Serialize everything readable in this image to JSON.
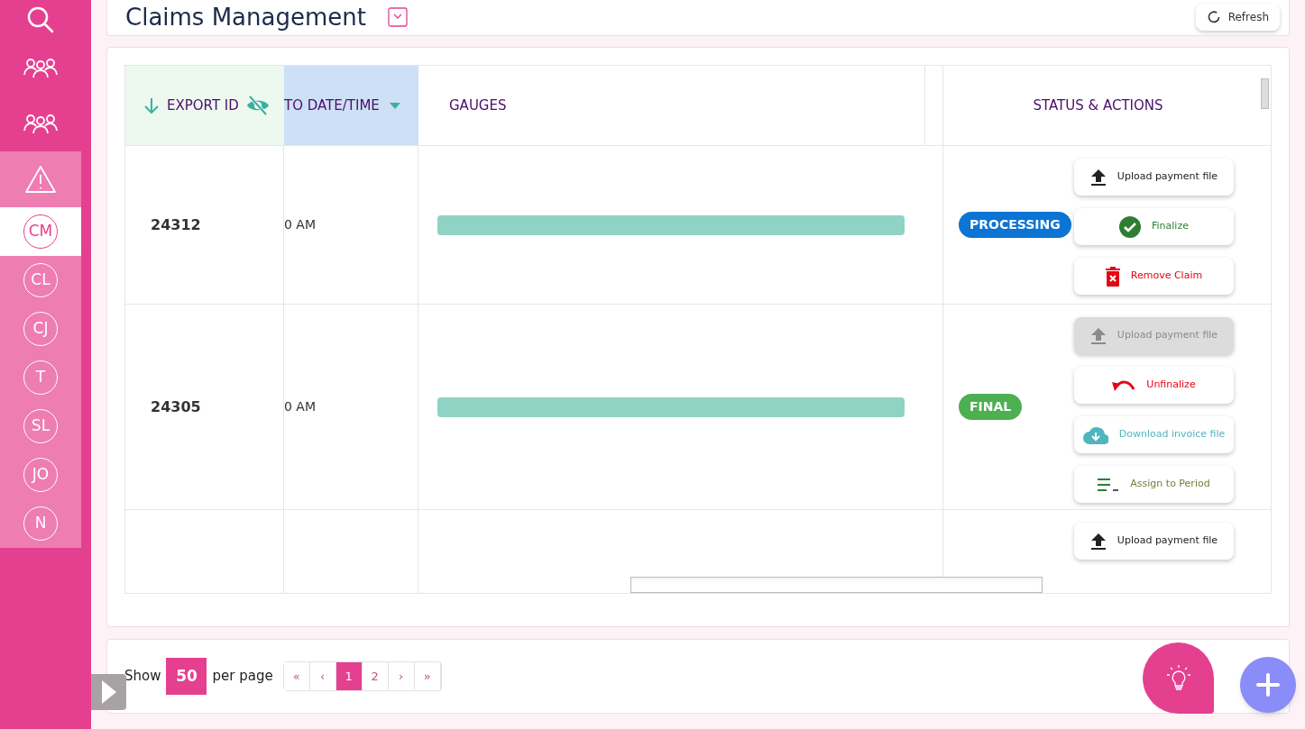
{
  "sidebar": {
    "items": [
      {
        "kind": "search",
        "selected": false
      },
      {
        "kind": "group",
        "selected": false
      },
      {
        "kind": "group",
        "selected": false
      },
      {
        "kind": "warning",
        "selected": false
      },
      {
        "kind": "initials",
        "label": "CM",
        "selected": true
      },
      {
        "kind": "initials",
        "label": "CL",
        "selected": false
      },
      {
        "kind": "initials",
        "label": "CJ",
        "selected": false
      },
      {
        "kind": "initials",
        "label": "T",
        "selected": false
      },
      {
        "kind": "initials",
        "label": "SL",
        "selected": false
      },
      {
        "kind": "initials",
        "label": "JO",
        "selected": false
      },
      {
        "kind": "initials",
        "label": "N",
        "selected": false
      }
    ]
  },
  "header": {
    "title": "Claims Management",
    "refresh": "Refresh"
  },
  "table": {
    "columns": [
      {
        "label": "EXPORT ID"
      },
      {
        "label": "TO DATE/TIME"
      },
      {
        "label": "GAUGES"
      },
      {
        "label": "STATUS & ACTIONS"
      }
    ],
    "rows": [
      {
        "export_id": "24312",
        "date": "0 AM",
        "status": {
          "label": "PROCESSING",
          "color": "#0b74d4"
        },
        "actions": [
          {
            "kind": "upload",
            "label": "Upload payment file",
            "disabled": false
          },
          {
            "kind": "finalize",
            "label": "Finalize",
            "disabled": false
          },
          {
            "kind": "remove",
            "label": "Remove Claim",
            "disabled": false
          }
        ]
      },
      {
        "export_id": "24305",
        "date": "0 AM",
        "status": {
          "label": "FINAL",
          "color": "#4caf50"
        },
        "actions": [
          {
            "kind": "upload",
            "label": "Upload payment file",
            "disabled": true
          },
          {
            "kind": "unfinalize",
            "label": "Unfinalize",
            "disabled": false
          },
          {
            "kind": "download",
            "label": "Download invoice file",
            "disabled": false
          },
          {
            "kind": "assign",
            "label": "Assign to Period",
            "disabled": false
          }
        ]
      },
      {
        "export_id": "",
        "date": "",
        "actions": [
          {
            "kind": "upload",
            "label": "Upload payment file",
            "disabled": false
          }
        ]
      }
    ]
  },
  "pagination": {
    "show": "Show",
    "per_page_value": "50",
    "per_page": "per page",
    "pages": [
      {
        "label": "«",
        "selected": false
      },
      {
        "label": "‹",
        "selected": false
      },
      {
        "label": "1",
        "selected": true
      },
      {
        "label": "2",
        "selected": false
      },
      {
        "label": "›",
        "selected": false
      },
      {
        "label": "»",
        "selected": false
      }
    ]
  }
}
